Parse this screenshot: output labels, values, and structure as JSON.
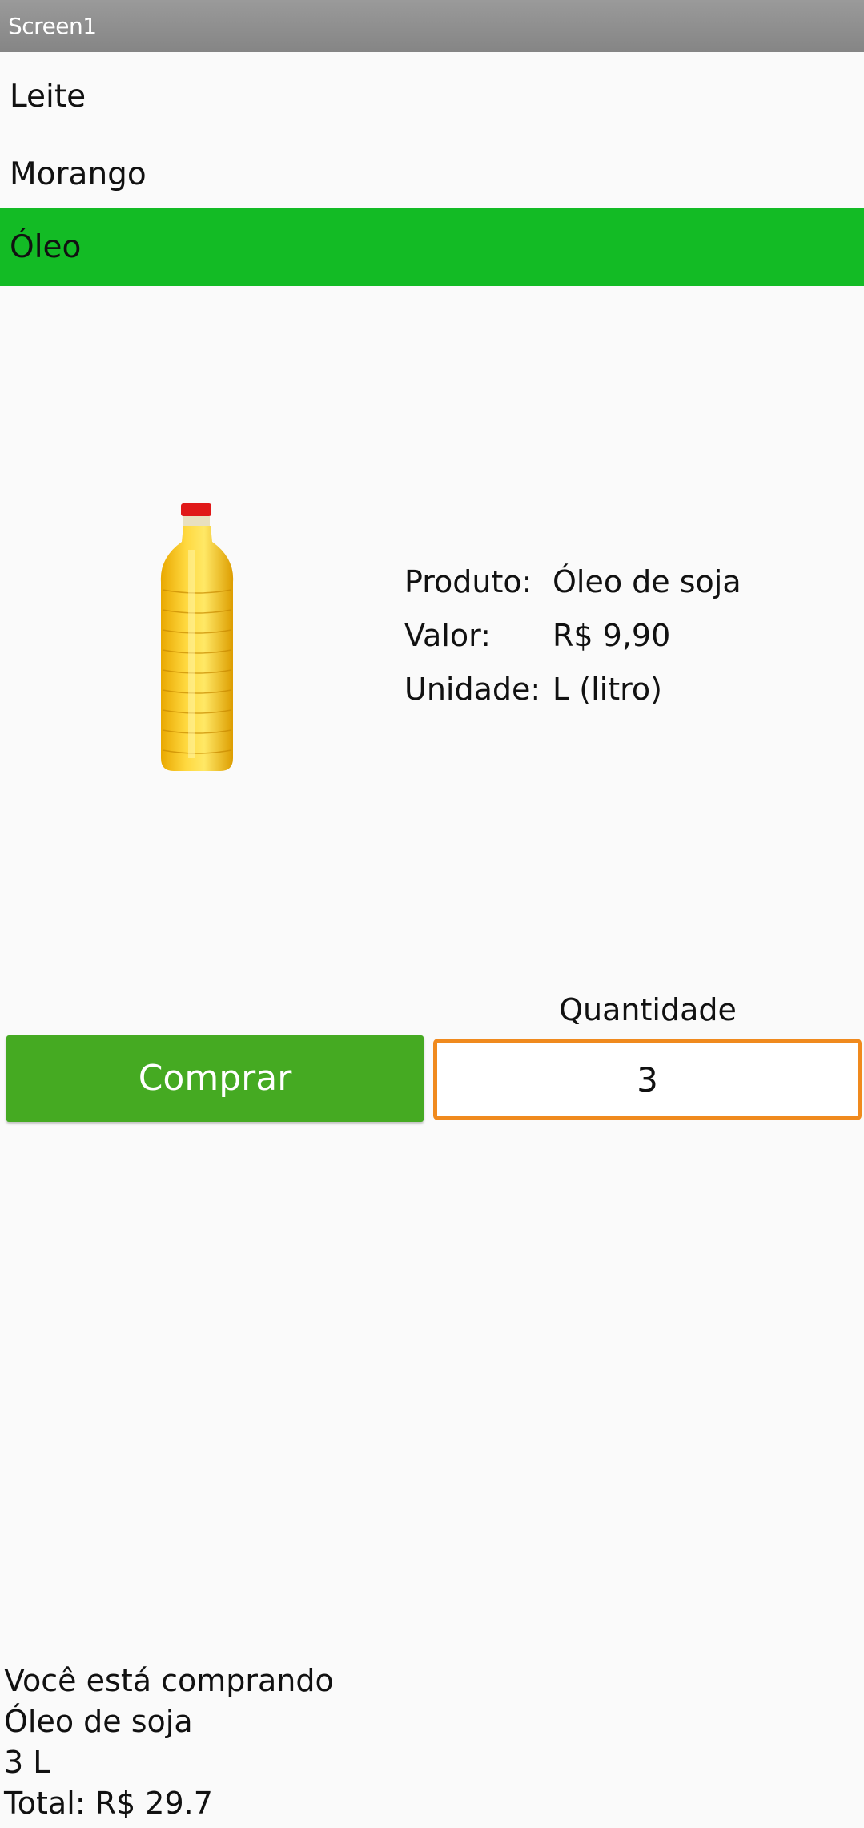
{
  "app": {
    "title": "Screen1"
  },
  "list": {
    "items": [
      {
        "label": "Leite"
      },
      {
        "label": "Morango"
      },
      {
        "label": "Óleo"
      }
    ],
    "selected_index": 2,
    "selected_color": "#13bb25"
  },
  "product": {
    "image_icon": "oil-bottle-icon",
    "produto_label": "Produto:",
    "produto_value": "Óleo de soja",
    "valor_label": "Valor:",
    "valor_value": "R$ 9,90",
    "unidade_label": "Unidade:",
    "unidade_value": "L (litro)"
  },
  "purchase": {
    "buy_label": "Comprar",
    "buy_color": "#45aa22",
    "quantity_label": "Quantidade",
    "quantity_value": "3",
    "input_border_color": "#f08a1e"
  },
  "summary": {
    "line1": "Você está comprando",
    "line2": "Óleo de soja",
    "line3": "3 L",
    "line4": "Total: R$ 29.7"
  }
}
